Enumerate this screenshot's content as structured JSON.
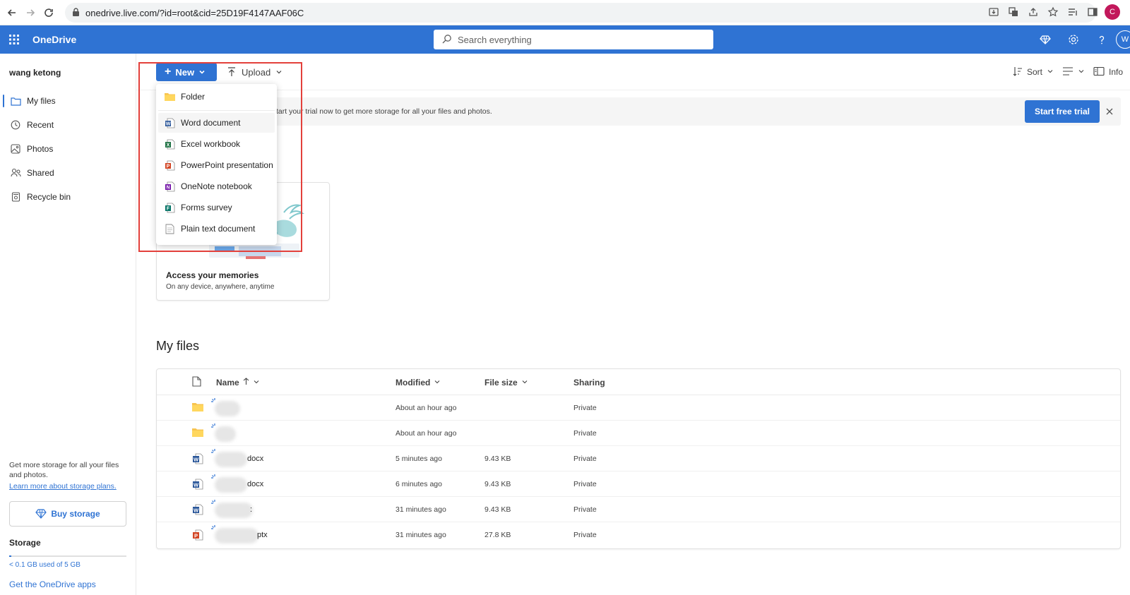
{
  "browser": {
    "url": "onedrive.live.com/?id=root&cid=25D19F4147AAF06C",
    "profile_initial": "C"
  },
  "app": {
    "name": "OneDrive",
    "search_placeholder": "Search everything",
    "avatar_initial": "W",
    "brand_color": "#2f73d3"
  },
  "sidebar": {
    "user_name": "wang ketong",
    "items": [
      {
        "label": "My files",
        "icon": "folder-icon",
        "active": true
      },
      {
        "label": "Recent",
        "icon": "clock-icon",
        "active": false
      },
      {
        "label": "Photos",
        "icon": "photo-icon",
        "active": false
      },
      {
        "label": "Shared",
        "icon": "people-icon",
        "active": false
      },
      {
        "label": "Recycle bin",
        "icon": "trash-icon",
        "active": false
      }
    ],
    "promo_text": "Get more storage for all your files and photos.",
    "promo_link": "Learn more about storage plans.",
    "buy_storage_label": "Buy storage",
    "storage_title": "Storage",
    "storage_used_text": "< 0.1 GB used of 5 GB",
    "storage_used_fraction": 0.02,
    "apps_link": "Get the OneDrive apps"
  },
  "command_bar": {
    "new_label": "New",
    "upload_label": "Upload",
    "sort_label": "Sort",
    "info_label": "Info"
  },
  "banner": {
    "text": "tart your trial now to get more storage for all your files and photos.",
    "trial_button": "Start free trial"
  },
  "card": {
    "title": "Access your memories",
    "subtitle": "On any device, anywhere, anytime"
  },
  "new_menu": {
    "items": [
      {
        "label": "Folder",
        "icon": "folder-icon"
      },
      {
        "label": "Word document",
        "icon": "word-icon"
      },
      {
        "label": "Excel workbook",
        "icon": "excel-icon"
      },
      {
        "label": "PowerPoint presentation",
        "icon": "powerpoint-icon"
      },
      {
        "label": "OneNote notebook",
        "icon": "onenote-icon"
      },
      {
        "label": "Forms survey",
        "icon": "forms-icon"
      },
      {
        "label": "Plain text document",
        "icon": "text-file-icon"
      }
    ]
  },
  "files": {
    "section_title": "My files",
    "columns": {
      "name": "Name",
      "modified": "Modified",
      "size": "File size",
      "sharing": "Sharing"
    },
    "rows": [
      {
        "type": "folder",
        "name_suffix": "",
        "modified": "About an hour ago",
        "size": "",
        "sharing": "Private"
      },
      {
        "type": "folder",
        "name_suffix": "",
        "modified": "About an hour ago",
        "size": "",
        "sharing": "Private"
      },
      {
        "type": "word",
        "name_suffix": "docx",
        "modified": "5 minutes ago",
        "size": "9.43 KB",
        "sharing": "Private"
      },
      {
        "type": "word",
        "name_suffix": "docx",
        "modified": "6 minutes ago",
        "size": "9.43 KB",
        "sharing": "Private"
      },
      {
        "type": "word",
        "name_suffix": ":",
        "modified": "31 minutes ago",
        "size": "9.43 KB",
        "sharing": "Private"
      },
      {
        "type": "powerpoint",
        "name_suffix": "ptx",
        "modified": "31 minutes ago",
        "size": "27.8 KB",
        "sharing": "Private"
      }
    ]
  }
}
